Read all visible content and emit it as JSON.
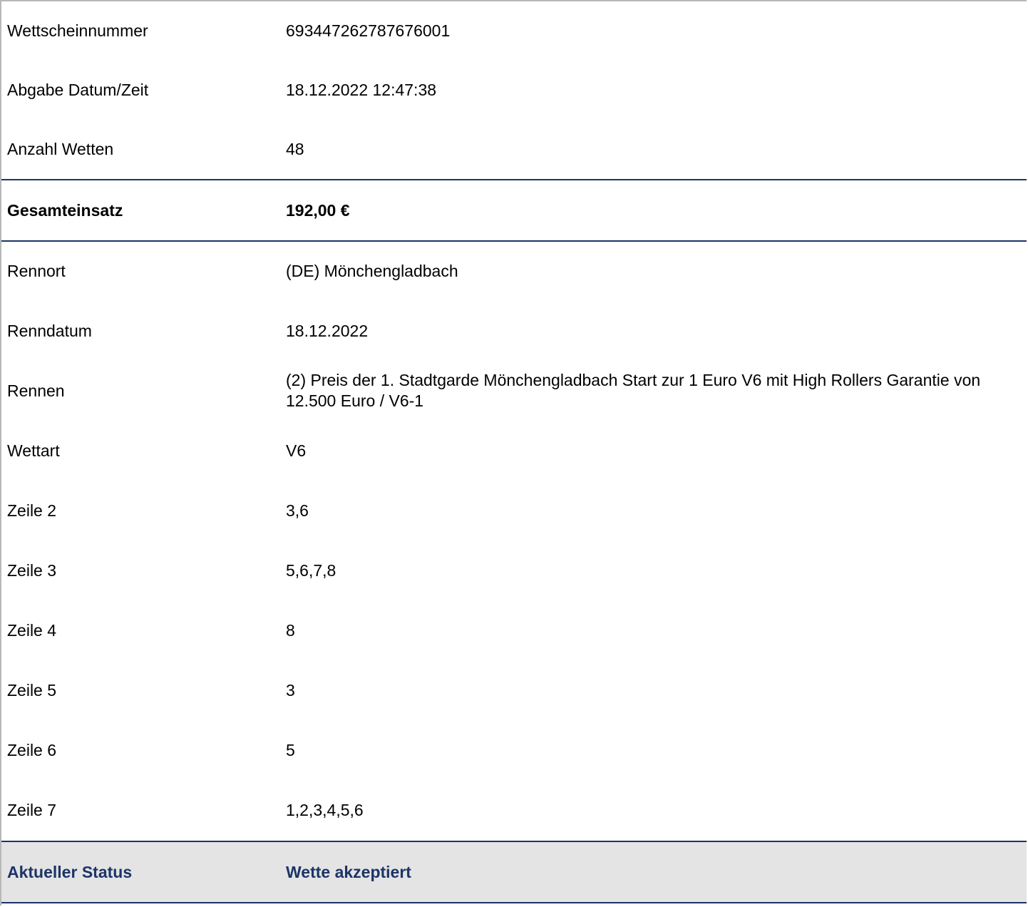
{
  "ticket": {
    "number_label": "Wettscheinnummer",
    "number_value": "693447262787676001",
    "submitted_label": "Abgabe Datum/Zeit",
    "submitted_value": "18.12.2022 12:47:38",
    "count_label": "Anzahl Wetten",
    "count_value": "48"
  },
  "total": {
    "label": "Gesamteinsatz",
    "value": "192,00 €"
  },
  "race": {
    "venue_label": "Rennort",
    "venue_value": "(DE) Mönchengladbach",
    "date_label": "Renndatum",
    "date_value": "18.12.2022",
    "race_label": "Rennen",
    "race_value": "(2) Preis der 1. Stadtgarde Mönchengladbach Start zur 1 Euro V6 mit High Rollers Garantie von 12.500 Euro / V6-1",
    "bettype_label": "Wettart",
    "bettype_value": "V6"
  },
  "lines": [
    {
      "label": "Zeile 2",
      "value": "3,6"
    },
    {
      "label": "Zeile 3",
      "value": "5,6,7,8"
    },
    {
      "label": "Zeile 4",
      "value": "8"
    },
    {
      "label": "Zeile 5",
      "value": "3"
    },
    {
      "label": "Zeile 6",
      "value": "5"
    },
    {
      "label": "Zeile 7",
      "value": "1,2,3,4,5,6"
    }
  ],
  "status": {
    "label": "Aktueller Status",
    "value": "Wette akzeptiert"
  },
  "colors": {
    "accent": "#1c3468",
    "status_background": "#e4e4e4"
  }
}
